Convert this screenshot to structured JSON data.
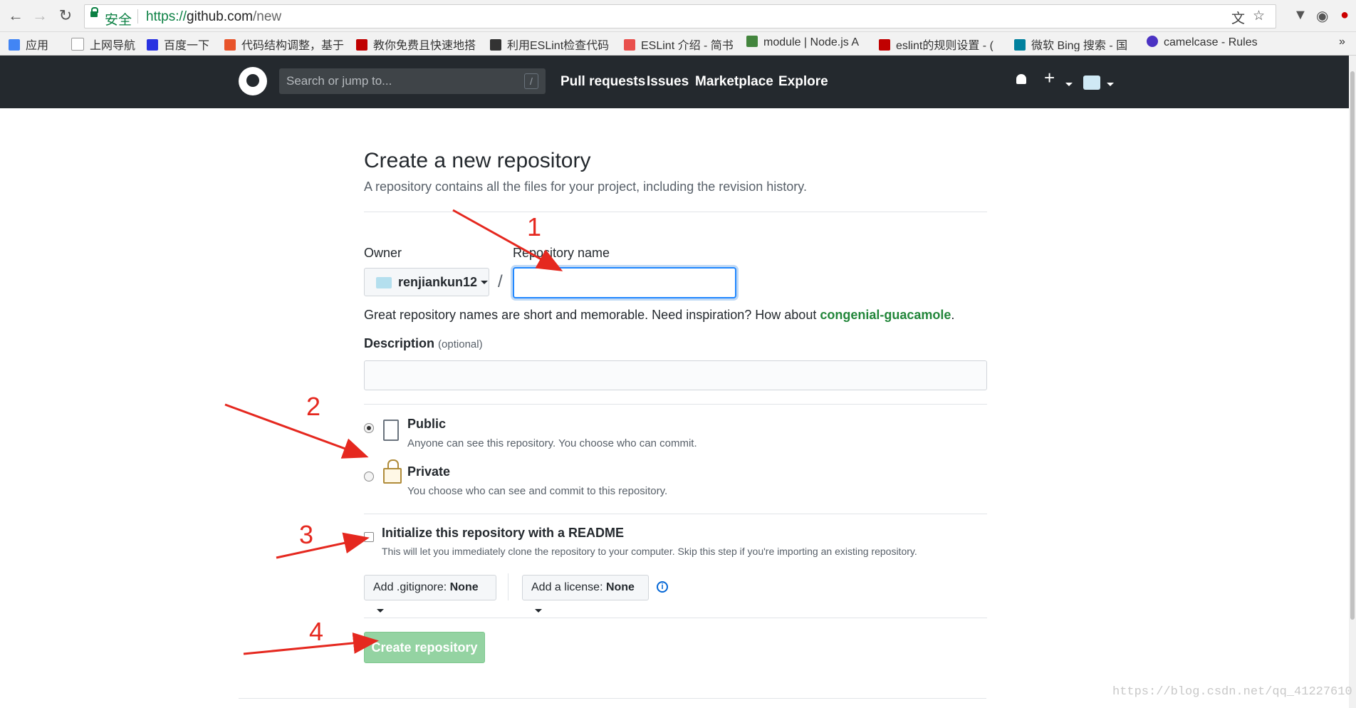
{
  "browser": {
    "secure_label": "安全",
    "url_scheme": "https://",
    "url_host": "github.com",
    "url_path": "/new",
    "bookmarks": [
      {
        "label": "应用",
        "color": "#4285f4"
      },
      {
        "label": "上网导航",
        "color": "#999999"
      },
      {
        "label": "百度一下",
        "color": "#2932e1"
      },
      {
        "label": "代码结构调整，基于",
        "color": "#e8542b"
      },
      {
        "label": "教你免费且快速地搭",
        "color": "#c00000"
      },
      {
        "label": "利用ESLint检查代码",
        "color": "#333333"
      },
      {
        "label": "ESLint 介绍 - 简书",
        "color": "#e9504d"
      },
      {
        "label": "module | Node.js A",
        "color": "#43853d"
      },
      {
        "label": "eslint的规则设置 - (",
        "color": "#c00000"
      },
      {
        "label": "微软 Bing 搜索 - 国",
        "color": "#00809d"
      },
      {
        "label": "camelcase - Rules",
        "color": "#4b32c3"
      }
    ],
    "more": "»"
  },
  "header": {
    "search_placeholder": "Search or jump to...",
    "slash_key": "/",
    "nav": [
      "Pull requests",
      "Issues",
      "Marketplace",
      "Explore"
    ],
    "plus": "+"
  },
  "page": {
    "title": "Create a new repository",
    "subtitle": "A repository contains all the files for your project, including the revision history.",
    "owner_label": "Owner",
    "owner_value": "renjiankun12",
    "separator": "/",
    "repo_name_label": "Repository name",
    "repo_name_value": "",
    "hint_prefix": "Great repository names are short and memorable. Need inspiration? How about ",
    "hint_suggestion": "congenial-guacamole",
    "hint_suffix": ".",
    "description_label": "Description",
    "description_optional": "(optional)",
    "description_value": "",
    "visibility": [
      {
        "title": "Public",
        "desc": "Anyone can see this repository. You choose who can commit.",
        "selected": true
      },
      {
        "title": "Private",
        "desc": "You choose who can see and commit to this repository.",
        "selected": false
      }
    ],
    "readme_label": "Initialize this repository with a README",
    "readme_desc": "This will let you immediately clone the repository to your computer. Skip this step if you're importing an existing repository.",
    "readme_checked": false,
    "gitignore_prefix": "Add .gitignore: ",
    "gitignore_value": "None",
    "license_prefix": "Add a license: ",
    "license_value": "None",
    "info_glyph": "i",
    "create_button": "Create repository"
  },
  "annotations": [
    "1",
    "2",
    "3",
    "4"
  ],
  "watermark": "https://blog.csdn.net/qq_41227610"
}
